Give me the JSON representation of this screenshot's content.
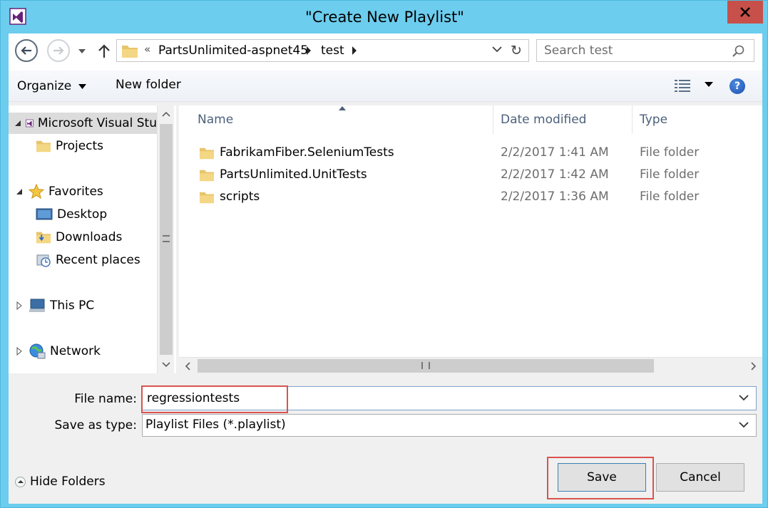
{
  "window": {
    "title": "\"Create New Playlist\"",
    "app_icon": "visual-studio-icon",
    "close_icon": "close-icon"
  },
  "address": {
    "overflow": "«",
    "parts": [
      "PartsUnlimited-aspnet45",
      "test"
    ]
  },
  "search": {
    "placeholder": "Search test"
  },
  "toolbar": {
    "organize_label": "Organize",
    "new_folder_label": "New folder"
  },
  "nav": {
    "items": [
      {
        "label": "Microsoft Visual Stu",
        "icon": "visual-studio-icon"
      },
      {
        "label": "Projects",
        "icon": "folder-icon"
      },
      {
        "label": "Favorites",
        "icon": "star-icon"
      },
      {
        "label": "Desktop",
        "icon": "desktop-icon"
      },
      {
        "label": "Downloads",
        "icon": "downloads-icon"
      },
      {
        "label": "Recent places",
        "icon": "recent-places-icon"
      },
      {
        "label": "This PC",
        "icon": "computer-icon"
      },
      {
        "label": "Network",
        "icon": "network-icon"
      }
    ]
  },
  "files": {
    "columns": [
      "Name",
      "Date modified",
      "Type"
    ],
    "rows": [
      {
        "name": "FabrikamFiber.SeleniumTests",
        "date": "2/2/2017 1:41 AM",
        "type": "File folder"
      },
      {
        "name": "PartsUnlimited.UnitTests",
        "date": "2/2/2017 1:42 AM",
        "type": "File folder"
      },
      {
        "name": "scripts",
        "date": "2/2/2017 1:36 AM",
        "type": "File folder"
      }
    ]
  },
  "form": {
    "filename_label": "File name:",
    "filename_value": "regressiontests",
    "savetype_label": "Save as type:",
    "savetype_value": "Playlist Files (*.playlist)"
  },
  "buttons": {
    "hide_folders": "Hide Folders",
    "save": "Save",
    "cancel": "Cancel"
  },
  "colors": {
    "titlebar": "#6ccdee",
    "close": "#c7504a",
    "highlight": "#d9534f"
  }
}
